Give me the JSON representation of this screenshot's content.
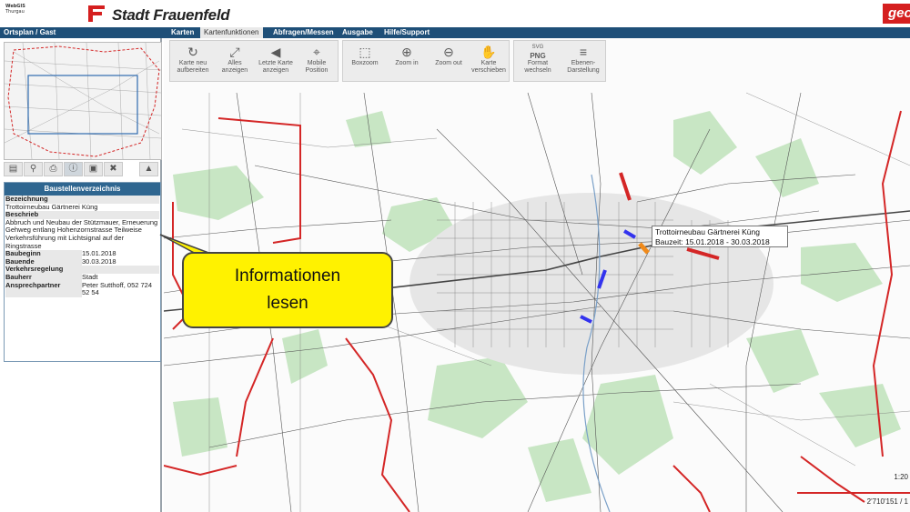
{
  "header": {
    "small_logo_line1": "WebGIS",
    "small_logo_line2": "Thurgau",
    "city_title": "Stadt Frauenfeld",
    "partner_logo": "geo",
    "brand_red": "#d51f1f",
    "nav_blue": "#1e4f78"
  },
  "nav": {
    "left_label": "Ortsplan / Gast",
    "tabs": [
      "Karten",
      "Kartenfunktionen",
      "Abfragen/Messen",
      "Ausgabe",
      "Hilfe/Support"
    ]
  },
  "toolbar": {
    "buttons": [
      {
        "label1": "Karte neu",
        "label2": "aufbereiten",
        "icon": "refresh-icon"
      },
      {
        "label1": "Alles",
        "label2": "anzeigen",
        "icon": "expand-icon"
      },
      {
        "label1": "Letzte Karte",
        "label2": "anzeigen",
        "icon": "back-arrow-icon"
      },
      {
        "label1": "Mobile",
        "label2": "Position",
        "icon": "crosshair-icon"
      },
      {
        "label1": "Boxzoom",
        "label2": "",
        "icon": "boxzoom-icon"
      },
      {
        "label1": "Zoom in",
        "label2": "",
        "icon": "zoom-in-icon"
      },
      {
        "label1": "Zoom out",
        "label2": "",
        "icon": "zoom-out-icon"
      },
      {
        "label1": "Karte",
        "label2": "verschieben",
        "icon": "hand-icon"
      },
      {
        "label1": "Format",
        "label2": "wechseln",
        "icon": "format-png-icon",
        "badge_top": "SVG",
        "badge_main": "PNG"
      },
      {
        "label1": "Ebenen-",
        "label2": "Darstellung",
        "icon": "layers-icon"
      }
    ]
  },
  "sidebar": {
    "tools": [
      "legend-icon",
      "search-icon",
      "print-icon",
      "info-icon",
      "lock-icon",
      "wrench-icon",
      "collapse-icon"
    ],
    "info_panel": {
      "title": "Baustellenverzeichnis",
      "bezeichnung_label": "Bezeichnung",
      "bezeichnung_value": "Trottoirneubau Gärtnerei Küng",
      "beschrieb_label": "Beschrieb",
      "beschrieb_value": "Abbruch und Neubau der Stützmauer, Erneuerung Gehweg entlang Hohenzornstrasse Teilweise Verkehrsführung mit Lichtsignal auf der Ringstrasse",
      "baubeginn_label": "Baubeginn",
      "baubeginn_value": "15.01.2018",
      "bauende_label": "Bauende",
      "bauende_value": "30.03.2018",
      "verkehrsregelung_label": "Verkehrsregelung",
      "bauherr_label": "Bauherr",
      "bauherr_value": "Stadt",
      "ansprechpartner_label": "Ansprechpartner",
      "ansprechpartner_value": "Peter Sutthoff, 052 724 52 54"
    }
  },
  "map": {
    "tooltip_line1": "Trottoirneubau Gärtnerei Küng",
    "tooltip_line2": "Bauzeit: 15.01.2018 - 30.03.2018",
    "scale_text": "1:20",
    "coord_text": "2'710'151 / 1",
    "callout_line1": "Informationen",
    "callout_line2": "lesen"
  }
}
